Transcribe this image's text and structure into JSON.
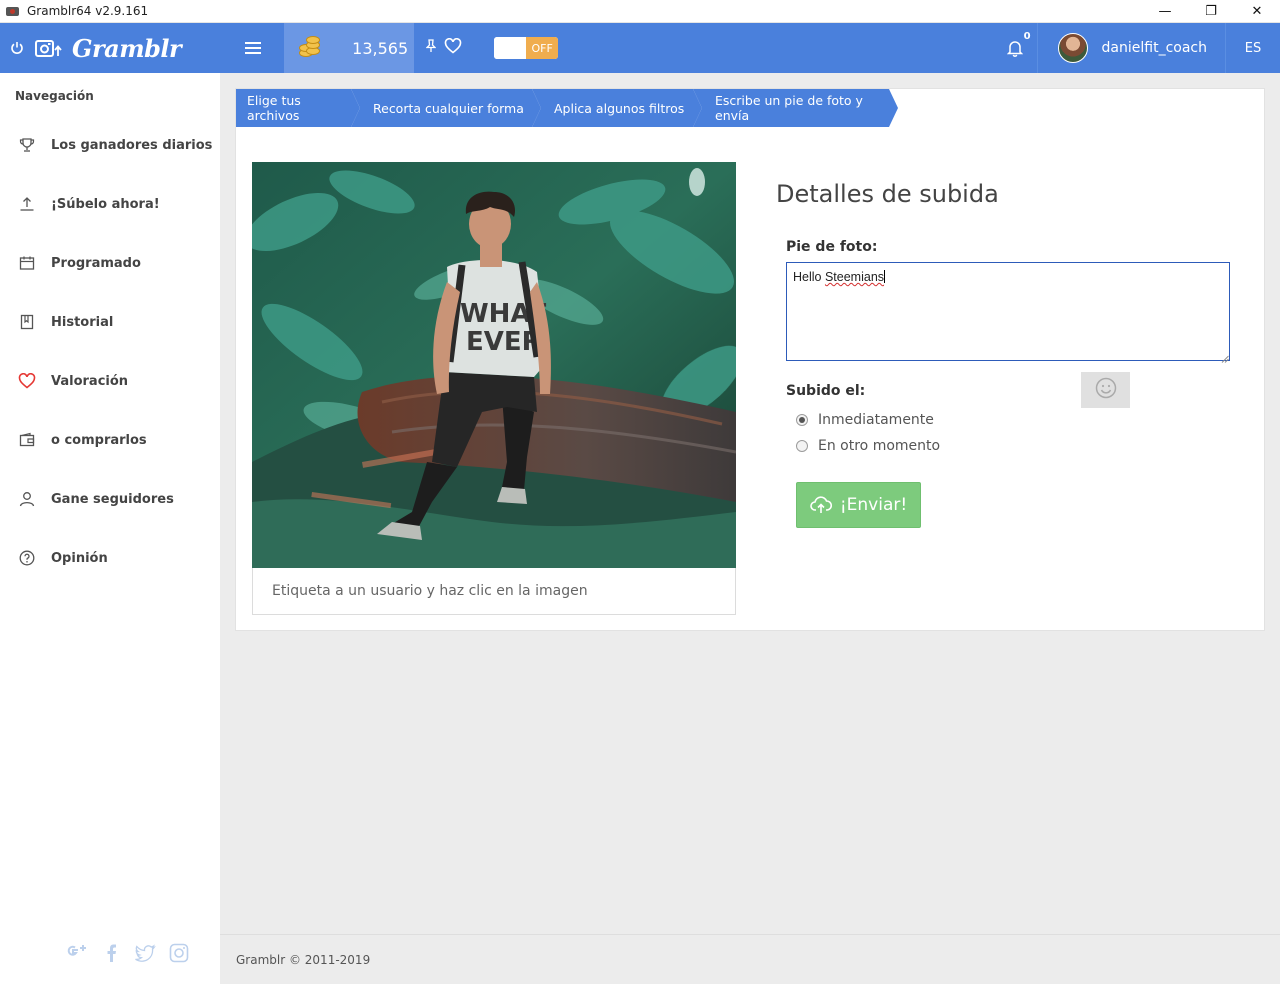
{
  "window": {
    "title": "Gramblr64 v2.9.161",
    "minimize": "—",
    "restore": "❐",
    "close": "✕"
  },
  "appbar": {
    "logo": "Gramblr",
    "coins": "13,565",
    "toggle_state": "OFF",
    "notifications": "0",
    "username": "danielfit_coach",
    "language": "ES",
    "accent_color": "#4a80dc"
  },
  "sidebar": {
    "title": "Navegación",
    "items": [
      {
        "label": "Los ganadores diarios",
        "icon": "trophy-icon"
      },
      {
        "label": "¡Súbelo ahora!",
        "icon": "upload-icon"
      },
      {
        "label": "Programado",
        "icon": "calendar-icon"
      },
      {
        "label": "Historial",
        "icon": "book-icon"
      },
      {
        "label": "Valoración",
        "icon": "heart-icon"
      },
      {
        "label": "o comprarlos",
        "icon": "wallet-icon"
      },
      {
        "label": "Gane seguidores",
        "icon": "user-icon"
      },
      {
        "label": "Opinión",
        "icon": "question-icon"
      }
    ],
    "socials": [
      "google-plus-icon",
      "facebook-icon",
      "twitter-icon",
      "instagram-icon"
    ]
  },
  "steps": [
    "Elige tus archivos",
    "Recorta cualquier forma",
    "Aplica algunos filtros",
    "Escribe un pie de foto y envía"
  ],
  "photo": {
    "tag_hint": "Etiqueta a un usuario y haz clic en la imagen",
    "shirt_text": "WHAT EVER"
  },
  "details": {
    "title": "Detalles de subida",
    "caption_label": "Pie de foto:",
    "caption_word1": "Hello ",
    "caption_word2": "Steemians",
    "uploaded_label": "Subido el:",
    "option_now": "Inmediatamente",
    "option_later": "En otro momento",
    "send_label": "¡Enviar!"
  },
  "footer": {
    "copyright": "Gramblr © 2011-2019"
  }
}
